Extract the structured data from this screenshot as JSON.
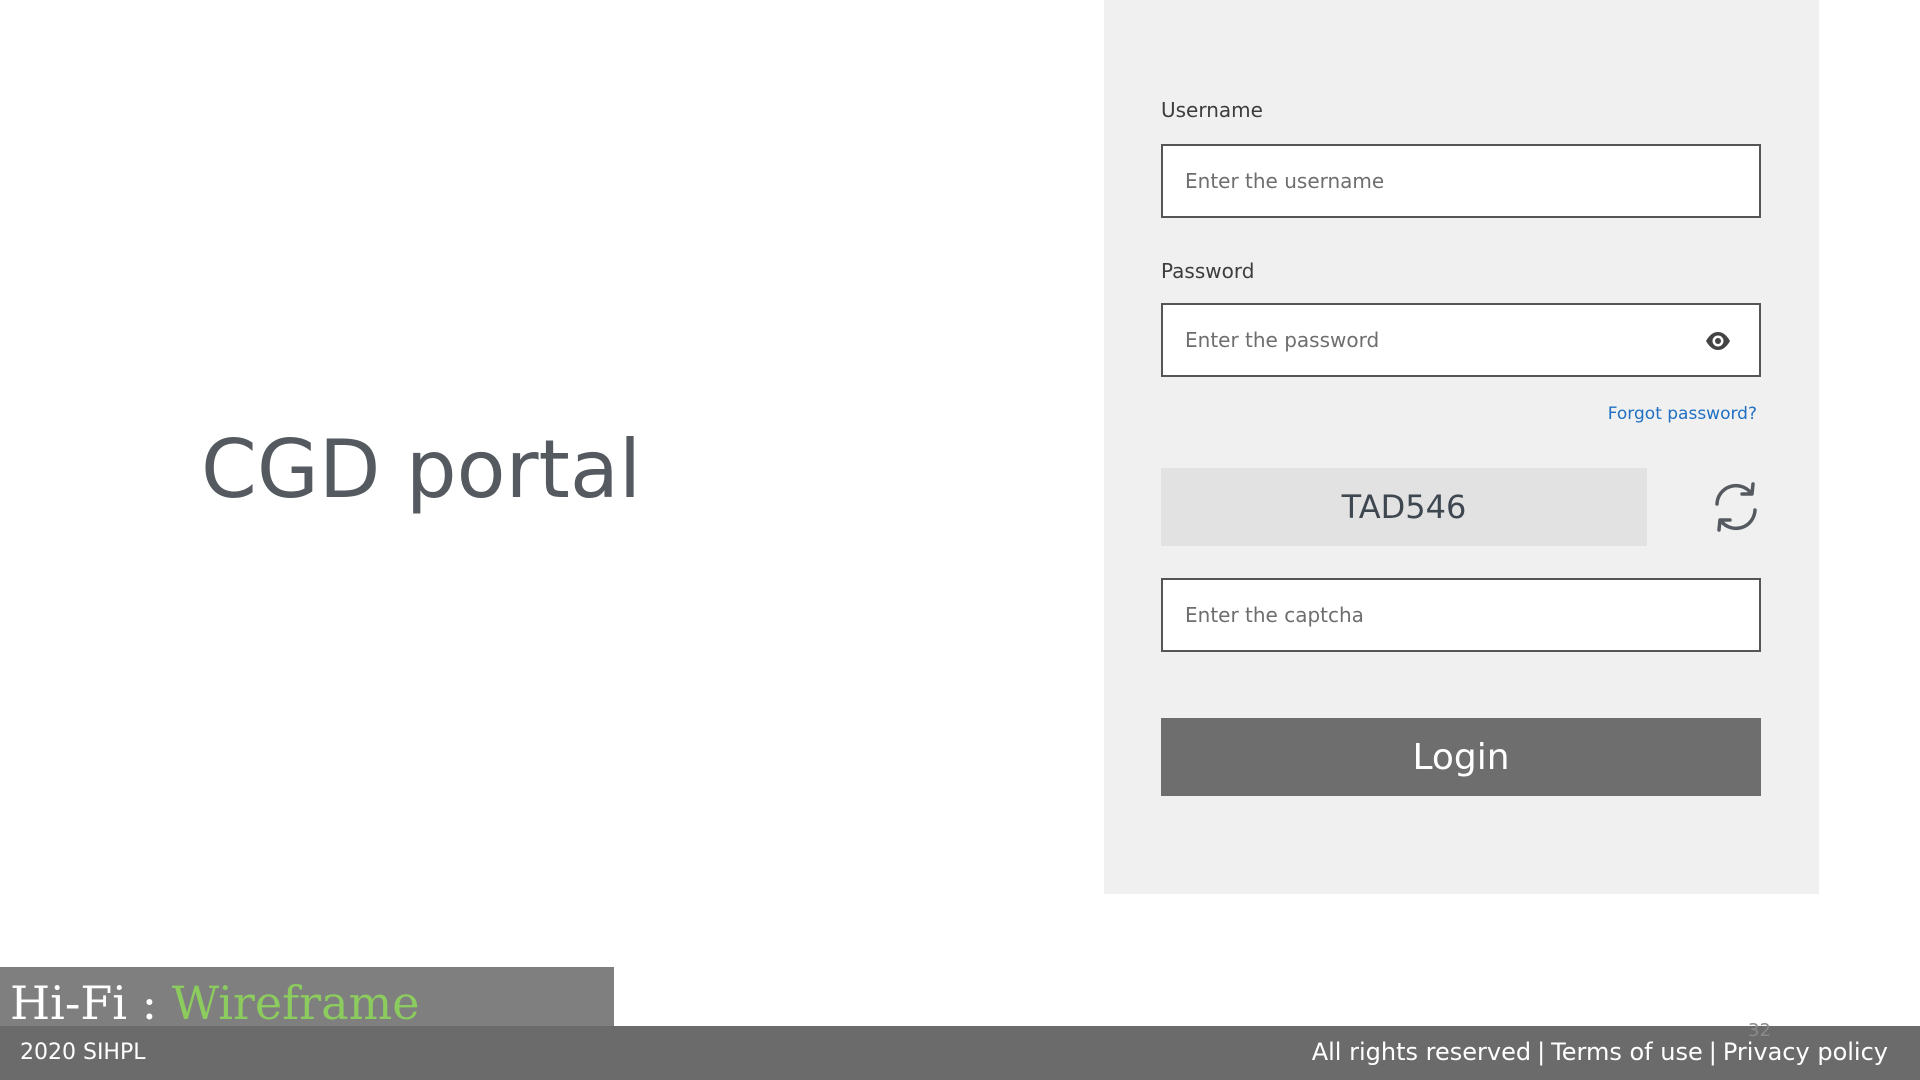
{
  "title": "CGD portal",
  "login": {
    "username_label": "Username",
    "username_placeholder": "Enter the username",
    "username_value": "",
    "password_label": "Password",
    "password_placeholder": "Enter the password",
    "password_value": "",
    "password_icon": "eye-icon",
    "forgot_password": "Forgot password?",
    "captcha_text": "TAD546",
    "captcha_refresh_icon": "refresh-icon",
    "captcha_placeholder": "Enter the captcha",
    "captcha_value": "",
    "login_button": "Login"
  },
  "wireframe_tag": {
    "prefix": "Hi-Fi : ",
    "accent": "Wireframe"
  },
  "footer": {
    "copyright": "2020 SIHPL",
    "links": [
      "All rights reserved",
      "Terms of use",
      "Privacy policy"
    ],
    "separator": "|",
    "page_number": "32"
  },
  "colors": {
    "panel_background": "#f0f0f0",
    "login_button": "#6e6e6e",
    "link": "#1f6fc2",
    "footer_background": "#6b6b6b",
    "wireframe_accent": "#8ccb5e"
  }
}
